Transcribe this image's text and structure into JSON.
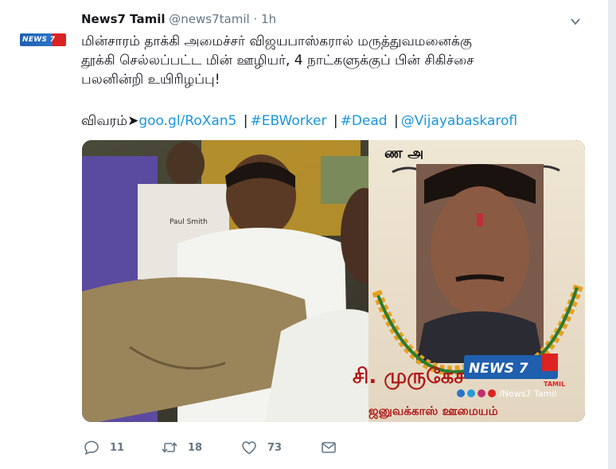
{
  "tweet": {
    "display_name": "News7 Tamil",
    "handle": "@news7tamil",
    "separator": "·",
    "time": "1h",
    "avatar_text": "NEWS 7",
    "text_lines": [
      "மின்சாரம் தாக்கி அமைச்சர் விஜயபாஸ்கரால் மருத்துவமனைக்கு",
      "தூக்கி செல்லப்பட்ட மின் ஊழியர், 4 நாட்களுக்குப் பின் சிகிச்சை",
      "பலனின்றி உயிரிழப்பு!"
    ],
    "link_lead": "விவரம்➤",
    "link_url": "goo.gl/RoXan5",
    "link_separator": "|",
    "hashtags": [
      "#EBWorker",
      "#Dead"
    ],
    "mention": "@Vijayabaskarofl",
    "media": {
      "banner_text": "சி. முருகேச",
      "banner_bottom_text": "ஜனுவக்காஸ் ஊமையம்",
      "watermark_logo": "NEWS 7",
      "watermark_logo_sub": "TAMIL",
      "watermark_handle": "/News7 Tamil",
      "watermark_icons": [
        "f",
        "t",
        "◎",
        "▶"
      ],
      "shirt_text": "Paul Smith"
    }
  },
  "actions": {
    "reply_count": "11",
    "retweet_count": "18",
    "like_count": "73"
  },
  "icons": {
    "reply": "reply-icon",
    "retweet": "retweet-icon",
    "like": "heart-icon",
    "message": "direct-message-icon",
    "caret": "chevron-down-icon"
  },
  "colors": {
    "link": "#1b95e0",
    "secondary_text": "#657786",
    "primary_text": "#14171a"
  }
}
